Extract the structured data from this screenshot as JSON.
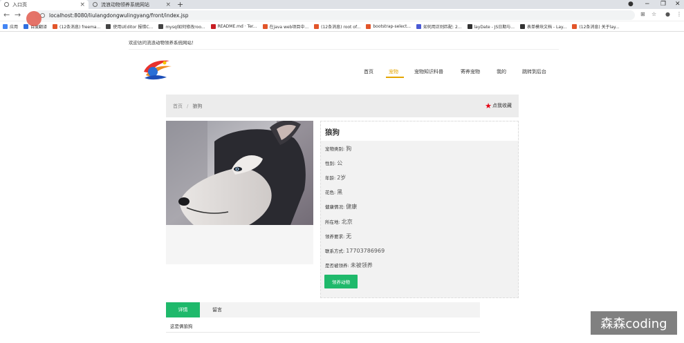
{
  "browser": {
    "tabs": [
      {
        "title": "入口页",
        "active": true
      },
      {
        "title": "流浪动物领养系统网站",
        "active": false
      }
    ],
    "url": "localhost:8080/liulangdongwulingyang/front/index.jsp",
    "bookmarks": [
      {
        "label": "应用",
        "color": "#4285f4"
      },
      {
        "label": "百度翻译",
        "color": "#2f6fe0"
      },
      {
        "label": "(12条消息) freema...",
        "color": "#e2552a"
      },
      {
        "label": "使用UEditor 报错C...",
        "color": "#444444"
      },
      {
        "label": "mysql如何修改roo...",
        "color": "#444444"
      },
      {
        "label": "README.md · Ter...",
        "color": "#c71d23"
      },
      {
        "label": "在java web项目中...",
        "color": "#e2552a"
      },
      {
        "label": "(12条消息) root of...",
        "color": "#e2552a"
      },
      {
        "label": "bootstrap-select...",
        "color": "#e2552a"
      },
      {
        "label": "如何用正则匹配: 2...",
        "color": "#4a5ad4"
      },
      {
        "label": "layDate - JS日期与...",
        "color": "#333333"
      },
      {
        "label": "表单模块文档 - Lay...",
        "color": "#333333"
      },
      {
        "label": "(12条消息) 关于lay...",
        "color": "#e2552a"
      }
    ]
  },
  "page": {
    "welcome": "欢迎访问流浪动物领养系统网站！",
    "nav": [
      "首页",
      "宠物",
      "宠物知识科普",
      "寄养宠物",
      "我的",
      "跳转到后台"
    ],
    "nav_active_index": 1,
    "accent_color": "#e4a500",
    "breadcrumb": {
      "home": "首页",
      "sep": "/",
      "current": "狼狗"
    },
    "favorite_label": "点我收藏",
    "pet": {
      "name": "狼狗",
      "fields": [
        {
          "label": "宠物类别:",
          "value": "狗"
        },
        {
          "label": "性别:",
          "value": "公"
        },
        {
          "label": "年龄:",
          "value": "2岁"
        },
        {
          "label": "花色:",
          "value": "黑"
        },
        {
          "label": "健康情况:",
          "value": "健康"
        },
        {
          "label": "所在地:",
          "value": "北京"
        },
        {
          "label": "领养要求:",
          "value": "无"
        },
        {
          "label": "联系方式:",
          "value": "17703786969"
        },
        {
          "label": "是否被领养:",
          "value": "未被领养"
        }
      ],
      "adopt_button": "领养动物"
    },
    "detail_tabs": [
      "详情",
      "留言"
    ],
    "detail_text": "这是俩狼狗",
    "button_color": "#1fb96b"
  },
  "watermark": "森森coding"
}
